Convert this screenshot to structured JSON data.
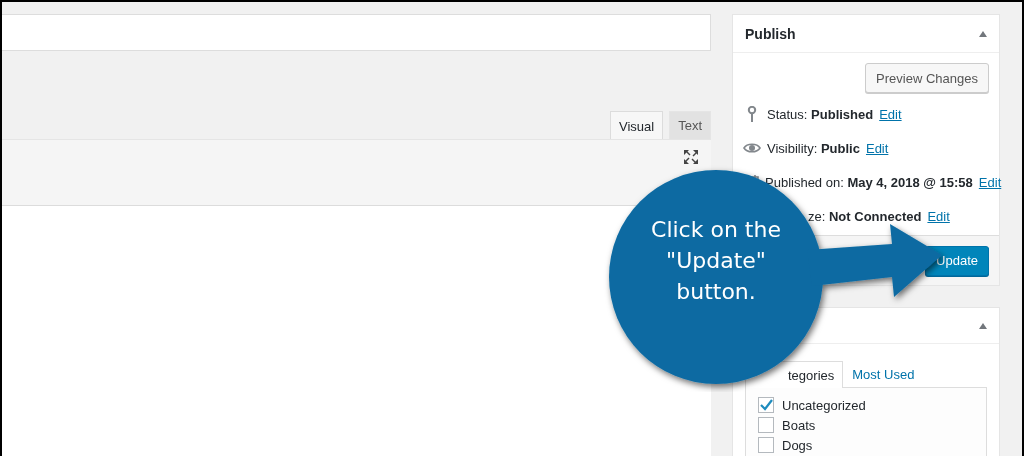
{
  "editor": {
    "tabs": [
      {
        "label": "Visual",
        "selected": true
      },
      {
        "label": "Text",
        "selected": false
      }
    ]
  },
  "publish": {
    "title": "Publish",
    "expanded": true,
    "preview_button": "Preview Changes",
    "rows": [
      {
        "kind": "status",
        "label": "Status:",
        "value": "Published",
        "link": "Edit"
      },
      {
        "kind": "visibility",
        "label": "Visibility:",
        "value": "Public",
        "link": "Edit"
      },
      {
        "kind": "date",
        "label": "Published on:",
        "value": "May 4, 2018 @ 15:58",
        "link": "Edit"
      },
      {
        "kind": "other",
        "label": "ze:",
        "value": "Not Connected",
        "link": "Edit"
      }
    ],
    "update_button": "Update"
  },
  "categories": {
    "expanded": true,
    "tabs": [
      {
        "label": "tegories",
        "selected": true
      },
      {
        "label": "Most Used",
        "selected": false
      }
    ],
    "items": [
      {
        "label": "Uncategorized",
        "checked": true
      },
      {
        "label": "Boats",
        "checked": false
      },
      {
        "label": "Dogs",
        "checked": false
      }
    ]
  },
  "callout": {
    "text": "Click on the \"Update\" button."
  }
}
